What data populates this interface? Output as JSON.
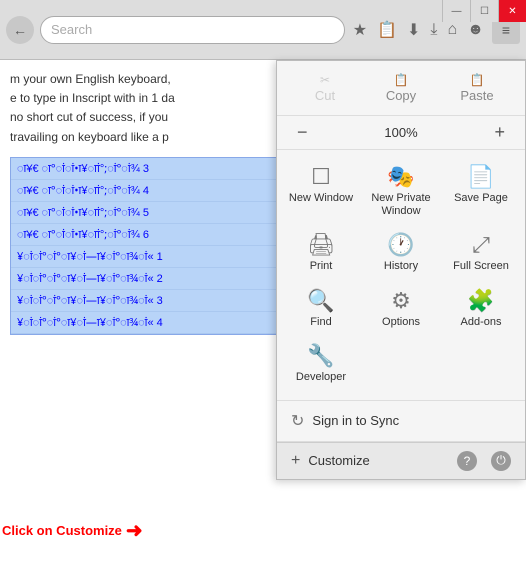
{
  "window": {
    "controls": {
      "minimize": "—",
      "maximize": "☐",
      "close": "✕"
    }
  },
  "toolbar": {
    "back_icon": "←",
    "search_placeholder": "Search",
    "star_icon": "★",
    "bookmark_icon": "📋",
    "pocket_icon": "⬇",
    "download_icon": "⤓",
    "home_icon": "⌂",
    "avatar_icon": "☻",
    "menu_icon": "≡"
  },
  "page": {
    "text_lines": [
      "m your own English keyboard,",
      "e to type in Inscript with in 1 da",
      "no short cut of success, if you",
      "travailing on keyboard like a p"
    ],
    "links": [
      "ा¥€ ा°ांां•ा¥ाां°;ां°ां¾ 3",
      "ा¥€ ा°ांां•ा¥ाां°;ां°ां¾ 4",
      "ा¥€ ा°ांां•ा¥ाां°;ां°ां¾ 5",
      "ा¥€ ा°ांां•ा¥ाां°;ां°ां¾ 6",
      "¥ांां°ां°ा¥ां—ा¥ां°ा¾ां« 1",
      "¥ांां°ां°ा¥ां—ा¥ां°ा¾ां« 2",
      "¥ांां°ां°ा¥ां—ा¥ां°ा¾ां« 3",
      "¥ांां°ां°ा¥ां—ा¥ां°ा¾ां« 4"
    ],
    "click_label": "Click on Customize"
  },
  "menu": {
    "edit_row": {
      "cut_label": "Cut",
      "copy_label": "Copy",
      "paste_label": "Paste"
    },
    "zoom": {
      "minus": "−",
      "value": "100%",
      "plus": "+"
    },
    "icons": [
      {
        "id": "new-window",
        "symbol": "☐",
        "label": "New Window"
      },
      {
        "id": "new-private-window",
        "symbol": "🎭",
        "label": "New Private Window"
      },
      {
        "id": "save-page",
        "symbol": "📄",
        "label": "Save Page"
      },
      {
        "id": "print",
        "symbol": "🖨",
        "label": "Print"
      },
      {
        "id": "history",
        "symbol": "🕐",
        "label": "History"
      },
      {
        "id": "full-screen",
        "symbol": "⤢",
        "label": "Full Screen"
      },
      {
        "id": "find",
        "symbol": "🔍",
        "label": "Find"
      },
      {
        "id": "options",
        "symbol": "⚙",
        "label": "Options"
      },
      {
        "id": "add-ons",
        "symbol": "🧩",
        "label": "Add-ons"
      },
      {
        "id": "developer",
        "symbol": "🔧",
        "label": "Developer"
      }
    ],
    "signin_icon": "↻",
    "signin_label": "Sign in to Sync",
    "customize_plus": "+",
    "customize_label": "Customize",
    "help_icon": "?",
    "power_icon": "⏻"
  }
}
